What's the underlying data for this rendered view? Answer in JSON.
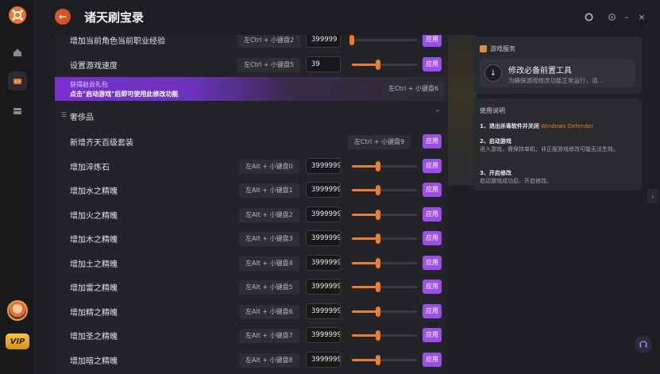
{
  "header": {
    "title": "诸天刷宝录",
    "back_icon": "arrow-left-icon"
  },
  "top_rows": [
    {
      "label": "增加当前角色当前职业经验",
      "hotkey": "左Ctrl + 小键盘2",
      "value": "399999",
      "level": 0.0,
      "apply": "应用"
    },
    {
      "label": "设置游戏速度",
      "hotkey": "左Ctrl + 小键盘5",
      "value": "39",
      "level": 0.4,
      "apply": "应用"
    }
  ],
  "banner": {
    "line1": "获得赵云礼包",
    "line2": "点击\"启动游戏\"后即可使用此修改功能",
    "hotkey": "左Ctrl + 小键盘6"
  },
  "section": {
    "name": "奢侈品"
  },
  "luxury_rows": [
    {
      "label": "新增齐天百级套装",
      "hotkey": "左Ctrl + 小键盘9",
      "apply": "应用"
    },
    {
      "label": "增加淬炼石",
      "hotkey": "左Alt + 小键盘0",
      "value": "3999999",
      "level": 0.4,
      "apply": "应用"
    },
    {
      "label": "增加水之精魄",
      "hotkey": "左Alt + 小键盘1",
      "value": "3999999",
      "level": 0.4,
      "apply": "应用"
    },
    {
      "label": "增加火之精魄",
      "hotkey": "左Alt + 小键盘2",
      "value": "3999999",
      "level": 0.4,
      "apply": "应用"
    },
    {
      "label": "增加木之精魄",
      "hotkey": "左Alt + 小键盘3",
      "value": "3999999",
      "level": 0.4,
      "apply": "应用"
    },
    {
      "label": "增加土之精魄",
      "hotkey": "左Alt + 小键盘4",
      "value": "3999999",
      "level": 0.4,
      "apply": "应用"
    },
    {
      "label": "增加雷之精魄",
      "hotkey": "左Alt + 小键盘5",
      "value": "3999999",
      "level": 0.4,
      "apply": "应用"
    },
    {
      "label": "增加精之精魄",
      "hotkey": "左Alt + 小键盘6",
      "value": "3999999",
      "level": 0.4,
      "apply": "应用"
    },
    {
      "label": "增加圣之精魄",
      "hotkey": "左Alt + 小键盘7",
      "value": "3999999",
      "level": 0.4,
      "apply": "应用"
    },
    {
      "label": "增加暗之精魄",
      "hotkey": "左Alt + 小键盘8",
      "value": "3999999",
      "level": 0.4,
      "apply": "应用"
    }
  ],
  "services": {
    "caption": "游戏服务",
    "item_title": "修改必备前置工具",
    "item_sub": "为确保游戏修改功能正常运行，请..."
  },
  "instructions": {
    "caption": "使用说明",
    "step1_title": "1、退出杀毒软件并关闭",
    "step1_highlight": "Windows Defender",
    "step2_title": "2、启动游戏",
    "step2_body": "进入游戏，需保持单机；非正版游戏修改可能无法生效。",
    "step3_title": "3、开启修改",
    "step3_body": "启动游戏成功后，开启修改。"
  },
  "rail": {
    "vip_label": "VIP"
  },
  "colors": {
    "accent": "#ef7d2f",
    "apply": "#9b4ee8",
    "banner": "#7b2fd2"
  }
}
